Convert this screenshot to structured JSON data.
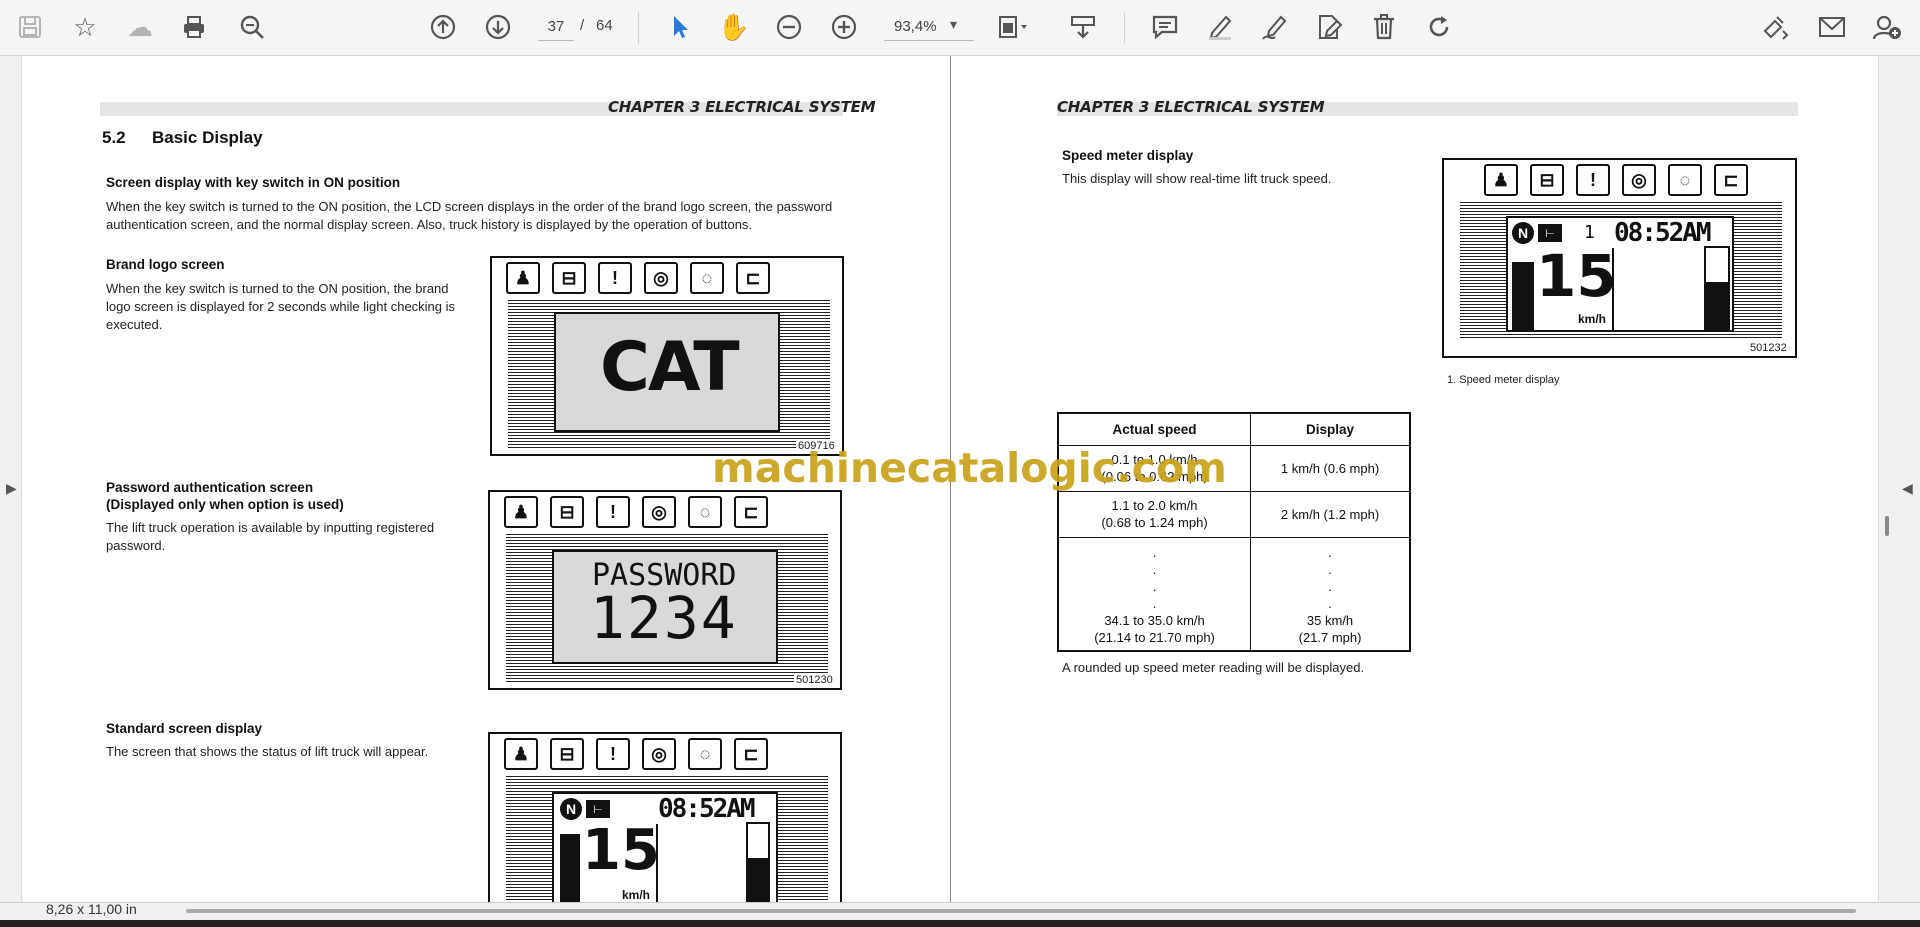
{
  "toolbar": {
    "page_current": "37",
    "page_separator": "/",
    "page_total": "64",
    "zoom": "93,4%",
    "icons": [
      "save-icon",
      "bookmark-star-icon",
      "upload-cloud-icon",
      "print-icon",
      "zoom-search-icon",
      "page-up-icon",
      "page-down-icon",
      "select-cursor-icon",
      "hand-pan-icon",
      "zoom-out-icon",
      "zoom-in-icon",
      "page-fit-icon",
      "scroll-mode-icon",
      "comment-icon",
      "highlight-pen-icon",
      "draw-icon",
      "sign-icon",
      "delete-icon",
      "rotate-icon",
      "share-link-icon",
      "email-icon",
      "add-user-icon"
    ]
  },
  "left_page": {
    "chapter": "CHAPTER 3 ELECTRICAL SYSTEM",
    "section_number": "5.2",
    "section_title": "Basic Display",
    "key_switch": {
      "heading": "Screen display with key switch in ON position",
      "body": "When the key switch is turned to the ON position, the LCD screen displays in the order of the brand logo screen, the password authentication screen, and the normal display screen. Also, truck history is displayed by the operation of buttons."
    },
    "brand_logo": {
      "heading": "Brand logo screen",
      "body": "When the key switch is turned to the ON position, the brand logo screen is displayed for 2 seconds while light checking is executed.",
      "logo_text": "CAT",
      "figure_number": "609716"
    },
    "password": {
      "heading_line1": "Password authentication screen",
      "heading_line2": "(Displayed only when option is used)",
      "body": "The lift truck operation is available by inputting registered password.",
      "screen_label": "PASSWORD",
      "screen_digits": "1234",
      "figure_number": "501230"
    },
    "standard": {
      "heading": "Standard screen display",
      "body": "The screen that shows the status of lift truck will appear.",
      "gear": "N",
      "time": "08:52AM",
      "speed": "15",
      "unit": "km/h"
    }
  },
  "right_page": {
    "chapter": "CHAPTER 3 ELECTRICAL SYSTEM",
    "speed_meter": {
      "heading": "Speed meter display",
      "body": "This display will show real-time lift truck speed.",
      "gear": "N",
      "marker": "1",
      "time": "08:52AM",
      "speed": "15",
      "unit": "km/h",
      "figure_number": "501232",
      "caption": "1.  Speed meter display"
    },
    "table": {
      "headers": [
        "Actual speed",
        "Display"
      ],
      "rows": [
        {
          "actual_1": "0.1 to 1.0 km/h",
          "actual_2": "(0.06 to 0.62 mph)",
          "display_1": "1 km/h (0.6 mph)"
        },
        {
          "actual_1": "1.1 to 2.0 km/h",
          "actual_2": "(0.68 to 1.24 mph)",
          "display_1": "2 km/h (1.2 mph)"
        },
        {
          "actual_1": "34.1 to 35.0 km/h",
          "actual_2": "(21.14 to 21.70 mph)",
          "display_1": "35 km/h",
          "display_2": "(21.7 mph)"
        }
      ]
    },
    "note": "A rounded up speed meter reading will be displayed."
  },
  "watermark": "machinecatalogic.com",
  "status": {
    "page_size": "8,26 x 11,00 in"
  }
}
